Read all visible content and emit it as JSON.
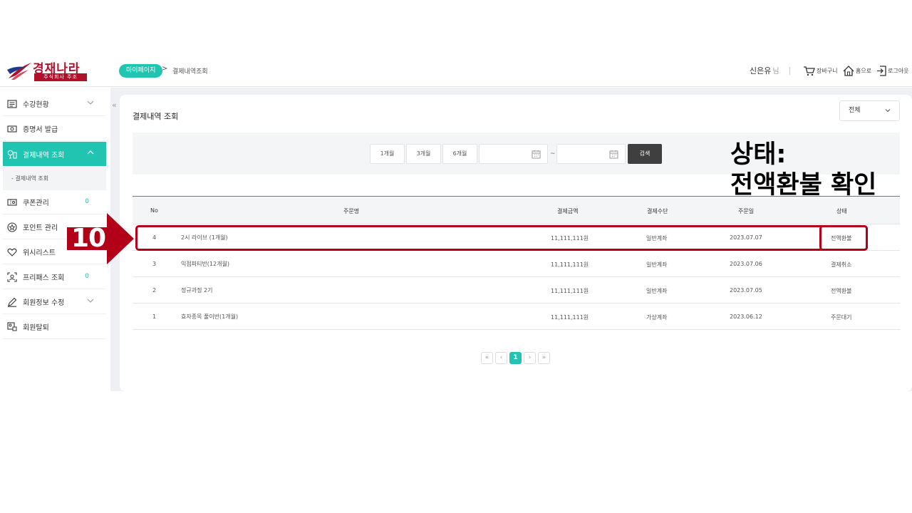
{
  "header": {
    "logo_name": "경재나라",
    "logo_sub": "주식회사 주조",
    "breadcrumb_home": "마이페이지",
    "breadcrumb_sep": ">",
    "breadcrumb_current": "결제내역조회",
    "user_name": "신은유",
    "user_suffix": "님",
    "cart_label": "장바구니",
    "home_label": "홈으로",
    "logout_label": "로그아웃"
  },
  "sidebar": {
    "collapse_icon": "«",
    "items": [
      {
        "label": "수강현황",
        "icon": "list-icon"
      },
      {
        "label": "증명서 발급",
        "icon": "certificate-icon"
      },
      {
        "label": "결제내역 조회",
        "icon": "receipt-icon"
      },
      {
        "label": "쿠폰관리",
        "icon": "coupon-icon",
        "count": "0"
      },
      {
        "label": "포인트 관리",
        "icon": "point-icon"
      },
      {
        "label": "위시리스트",
        "icon": "heart-icon"
      },
      {
        "label": "프리패스 조회",
        "icon": "pass-icon",
        "count": "0"
      },
      {
        "label": "회원정보 수정",
        "icon": "pencil-icon"
      },
      {
        "label": "회원탈퇴",
        "icon": "withdraw-icon"
      }
    ],
    "sub_item": "- 결제내역 조회"
  },
  "main": {
    "title": "결제내역 조회",
    "filter_select": "전체",
    "period_buttons": [
      "1개월",
      "3개월",
      "6개월"
    ],
    "date_from": "",
    "date_to": "",
    "tilde": "~",
    "search_label": "검색"
  },
  "table": {
    "columns": [
      "No",
      "주문명",
      "결제금액",
      "결제수단",
      "주문일",
      "상태"
    ],
    "rows": [
      {
        "no": "4",
        "name": "2시 라이브 (1개월)",
        "amount": "11,111,111원",
        "method": "일반계좌",
        "date": "2023.07.07",
        "status": "전액환불"
      },
      {
        "no": "3",
        "name": "익점파티반(12개월)",
        "amount": "11,111,111원",
        "method": "일반계좌",
        "date": "2023.07.06",
        "status": "결제취소"
      },
      {
        "no": "2",
        "name": "정규과정 2기",
        "amount": "11,111,111원",
        "method": "일반계좌",
        "date": "2023.07.05",
        "status": "전액환불"
      },
      {
        "no": "1",
        "name": "효자종목 풀이반(1개월)",
        "amount": "11,111,111원",
        "method": "가상계좌",
        "date": "2023.06.12",
        "status": "주문대기"
      }
    ]
  },
  "pagination": {
    "first": "«",
    "prev": "‹",
    "current": "1",
    "next": "›",
    "last": "»"
  },
  "annotation": {
    "step": "10",
    "note_line1": "상태:",
    "note_line2": "전액환불 확인",
    "color": "#b20018"
  },
  "colors": {
    "accent": "#20c4b0",
    "brand": "#b0102a"
  }
}
